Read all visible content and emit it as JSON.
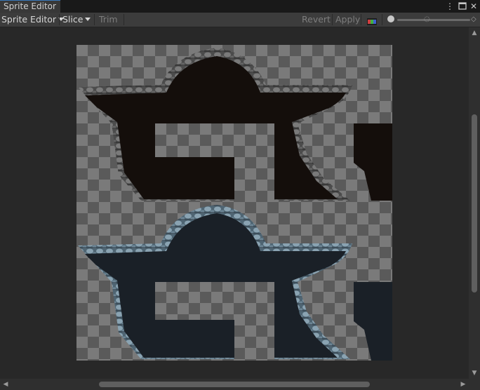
{
  "window": {
    "tab_title": "Sprite Editor",
    "menu_icon": "vertical-dots-icon",
    "maximize_icon": "maximize-icon",
    "close_icon": "close-icon"
  },
  "toolbar": {
    "sprite_editor_dropdown": "Sprite Editor",
    "slice_dropdown": "Slice",
    "trim_label": "Trim",
    "revert_label": "Revert",
    "apply_label": "Apply",
    "color_channel_icon": "rgb-channel-icon",
    "zoom_slider_value": 0.05,
    "mip_slider_value": 0.5
  },
  "colors": {
    "accent": "#3a79bb",
    "dark_tile": "#140e0b",
    "blue_tile": "#1a2027",
    "rock_dark": "#5b5b5b",
    "rock_blue": "#6e8797"
  }
}
